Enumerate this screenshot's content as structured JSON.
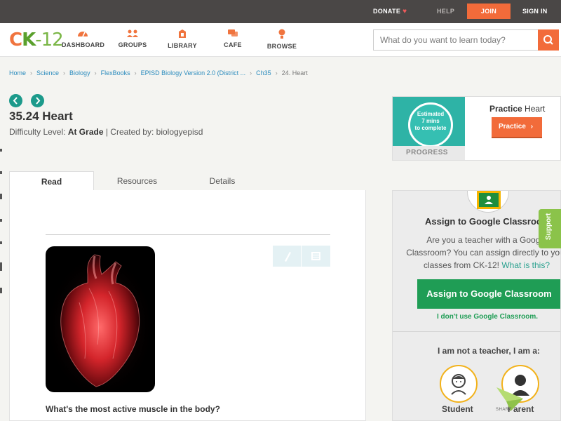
{
  "topbar": {
    "donate_label": "DONATE",
    "help_label": "HELP",
    "join_label": "JOIN",
    "signin_label": "SIGN IN"
  },
  "nav": {
    "logo": {
      "c": "C",
      "k": "K",
      "dash": "-",
      "num": "12"
    },
    "items": [
      {
        "label": "DASHBOARD",
        "icon": "dashboard-icon"
      },
      {
        "label": "GROUPS",
        "icon": "groups-icon"
      },
      {
        "label": "LIBRARY",
        "icon": "library-icon"
      },
      {
        "label": "CAFE",
        "icon": "cafe-icon"
      },
      {
        "label": "BROWSE",
        "icon": "browse-icon"
      }
    ],
    "search_placeholder": "What do you want to learn today?"
  },
  "breadcrumb": {
    "items": [
      "Home",
      "Science",
      "Biology",
      "FlexBooks",
      "EPISD Biology Version 2.0 (District ...",
      "Ch35"
    ],
    "current": "24. Heart"
  },
  "page": {
    "title": "35.24 Heart",
    "difficulty_prefix": "Difficulty Level: ",
    "difficulty": "At Grade",
    "created_by": " | Created by: biologyepisd"
  },
  "tabs": [
    {
      "label": "Read",
      "active": true
    },
    {
      "label": "Resources",
      "active": false
    },
    {
      "label": "Details",
      "active": false
    }
  ],
  "content": {
    "question": "What's the most active muscle in the body?"
  },
  "practice": {
    "progress_text": [
      "Estimated",
      "7 mins",
      "to complete"
    ],
    "progress_label": "PROGRESS",
    "title_bold": "Practice",
    "title_rest": " Heart",
    "button_label": "Practice"
  },
  "classroom": {
    "title": "Assign to Google Classroom",
    "desc": "Are you a teacher with a Google Classroom? You can assign directly to your classes from CK-12!",
    "link": "What is this?",
    "button_label": "Assign to Google Classroom",
    "no_use": "I don't use Google Classroom.",
    "iam": "I am not a teacher, I am a:",
    "roles": [
      "Student",
      "Parent"
    ]
  },
  "support_label": "Support",
  "share_label": "SHARE",
  "colors": {
    "accent": "#f26b3a",
    "teal": "#1c9a8b",
    "green": "#1f9d55",
    "link": "#2a8bbd"
  }
}
